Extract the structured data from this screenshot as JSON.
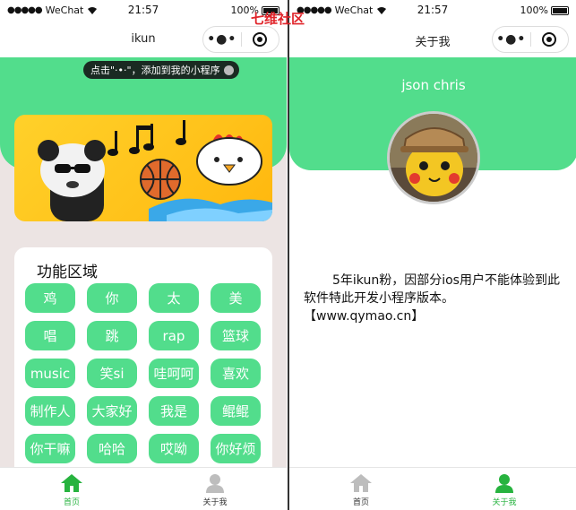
{
  "watermark": "七维社区",
  "left": {
    "status": {
      "carrier": "WeChat",
      "time": "21:57",
      "battery": "100%"
    },
    "nav": {
      "title": "ikun"
    },
    "tip": "点击\"·•·\"，添加到我的小程序",
    "function_area": {
      "title": "功能区域",
      "buttons": [
        "鸡",
        "你",
        "太",
        "美",
        "唱",
        "跳",
        "rap",
        "篮球",
        "music",
        "笑si",
        "哇呵呵",
        "喜欢",
        "制作人",
        "大家好",
        "我是",
        "鲲鲲",
        "你干嘛",
        "哈哈",
        "哎呦",
        "你好烦"
      ]
    },
    "tabs": [
      {
        "label": "首页",
        "active": true,
        "icon": "home-icon"
      },
      {
        "label": "关于我",
        "active": false,
        "icon": "user-icon"
      }
    ]
  },
  "right": {
    "status": {
      "carrier": "WeChat",
      "time": "21:57",
      "battery": "100%"
    },
    "nav": {
      "title": "关于我"
    },
    "profile": {
      "name": "json chris"
    },
    "about": {
      "text_line1": "5年ikun粉，因部分ios用户不能体验到此软件特此开发小程序版本。",
      "text_link": "【www.qymao.cn】"
    },
    "tabs": [
      {
        "label": "首页",
        "active": false,
        "icon": "home-icon"
      },
      {
        "label": "关于我",
        "active": true,
        "icon": "user-icon"
      }
    ]
  },
  "colors": {
    "primary_green": "#52dd8c",
    "active_tab": "#27b33f",
    "page_bg": "#ece4e3"
  }
}
